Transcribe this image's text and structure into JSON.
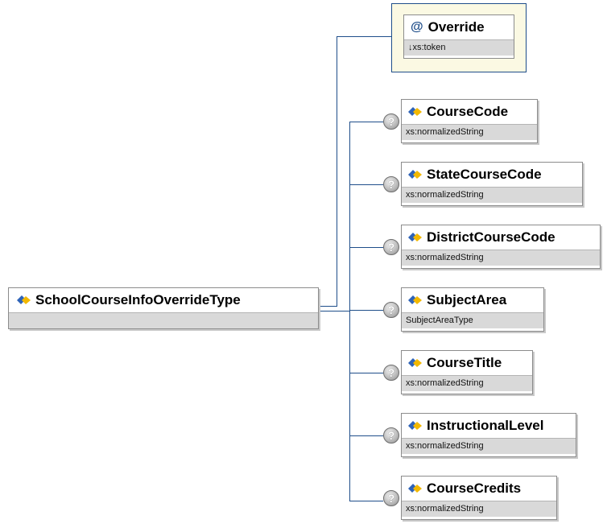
{
  "root": {
    "name": "SchoolCourseInfoOverrideType",
    "type": ""
  },
  "attribute": {
    "symbol": "@",
    "name": "Override",
    "type": "↓xs:token"
  },
  "optional_marker": "?",
  "elements": [
    {
      "name": "CourseCode",
      "type": "xs:normalizedString"
    },
    {
      "name": "StateCourseCode",
      "type": "xs:normalizedString"
    },
    {
      "name": "DistrictCourseCode",
      "type": "xs:normalizedString"
    },
    {
      "name": "SubjectArea",
      "type": "SubjectAreaType"
    },
    {
      "name": "CourseTitle",
      "type": "xs:normalizedString"
    },
    {
      "name": "InstructionalLevel",
      "type": "xs:normalizedString"
    },
    {
      "name": "CourseCredits",
      "type": "xs:normalizedString"
    }
  ]
}
